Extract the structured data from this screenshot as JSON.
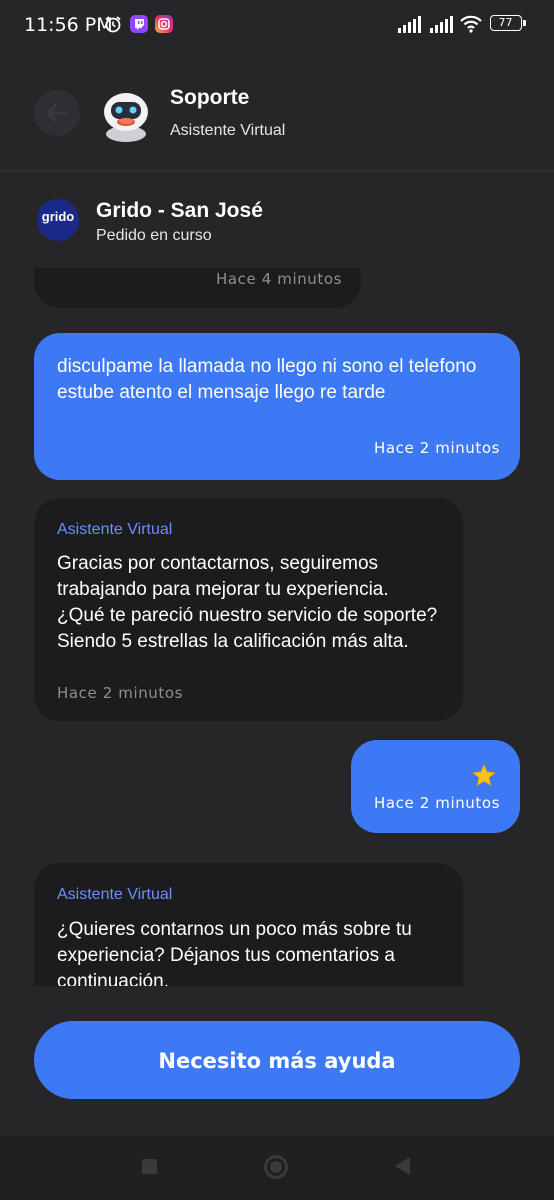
{
  "status_bar": {
    "time": "11:56 PM",
    "battery": "77"
  },
  "header": {
    "title": "Soporte",
    "subtitle": "Asistente Virtual"
  },
  "store": {
    "logo_text": "grido",
    "name": "Grido - San José",
    "status": "Pedido en curso"
  },
  "messages": [
    {
      "sender": "bot",
      "time": "Hace 4 minutos"
    },
    {
      "sender": "user",
      "text": "disculpame la llamada no llego ni sono el telefono estube atento el mensaje llego re tarde",
      "time": "Hace 2 minutos"
    },
    {
      "sender": "bot",
      "name": "Asistente Virtual",
      "text": "Gracias por contactarnos, seguiremos trabajando para mejorar tu experiencia. ¿Qué te pareció nuestro servicio de soporte? Siendo 5 estrellas la calificación más alta.",
      "time": "Hace 2 minutos"
    },
    {
      "sender": "user",
      "rating_stars": 1,
      "time": "Hace 2 minutos"
    },
    {
      "sender": "bot",
      "name": "Asistente Virtual",
      "text": "¿Quieres contarnos un poco más sobre tu experiencia? Déjanos tus comentarios a continuación."
    }
  ],
  "help_button": {
    "label": "Necesito más ayuda"
  },
  "colors": {
    "background": "#262629",
    "bot_bubble": "#1c1c1e",
    "user_bubble": "#3d79f5",
    "bot_name": "#6c8eff",
    "star": "#f5c518"
  }
}
